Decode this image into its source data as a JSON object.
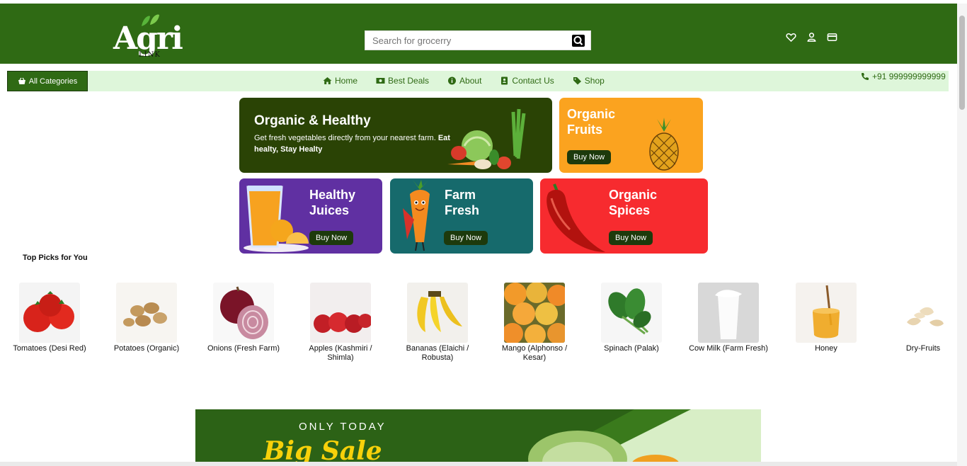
{
  "header": {
    "logo_text": "Agri",
    "logo_sub": "LINK",
    "search_placeholder": "Search for grocerry",
    "icons": [
      "heart-icon",
      "user-icon",
      "card-icon"
    ]
  },
  "nav": {
    "all_categories": "All Categories",
    "links": [
      {
        "label": "Home",
        "icon": "home-icon"
      },
      {
        "label": "Best Deals",
        "icon": "money-icon"
      },
      {
        "label": "About",
        "icon": "info-icon"
      },
      {
        "label": "Contact Us",
        "icon": "contact-icon"
      },
      {
        "label": "Shop",
        "icon": "tag-icon"
      }
    ],
    "phone": "+91 999999999999"
  },
  "banners": {
    "main": {
      "title": "Organic & Healthy",
      "desc": "Get fresh vegetables directly from your nearest farm.",
      "desc_bold": "Eat healty, Stay Healty"
    },
    "fruits": {
      "title_line1": "Organic",
      "title_line2": "Fruits",
      "button": "Buy Now"
    },
    "juices": {
      "title_line1": "Healthy",
      "title_line2": "Juices",
      "button": "Buy Now"
    },
    "farm": {
      "title_line1": "Farm",
      "title_line2": "Fresh",
      "button": "Buy Now"
    },
    "spices": {
      "title_line1": "Organic",
      "title_line2": "Spices",
      "button": "Buy Now"
    }
  },
  "top_picks": {
    "title": "Top Picks for You",
    "items": [
      {
        "name": "Tomatoes (Desi Red)"
      },
      {
        "name": "Potatoes (Organic)"
      },
      {
        "name": "Onions (Fresh Farm)"
      },
      {
        "name": "Apples (Kashmiri / Shimla)"
      },
      {
        "name": "Bananas (Elaichi / Robusta)"
      },
      {
        "name": "Mango (Alphonso / Kesar)"
      },
      {
        "name": "Spinach (Palak)"
      },
      {
        "name": "Cow Milk (Farm Fresh)"
      },
      {
        "name": "Honey"
      },
      {
        "name": "Dry-Fruits"
      }
    ]
  },
  "sale": {
    "only_today": "ONLY TODAY",
    "big_sale": "Big Sale"
  },
  "colors": {
    "brand_green": "#2f6a14",
    "nav_bg": "#def6da",
    "fruits_bg": "#fba31f",
    "juices_bg": "#6030a2",
    "farm_bg": "#166a6c",
    "spices_bg": "#f72b2f"
  }
}
